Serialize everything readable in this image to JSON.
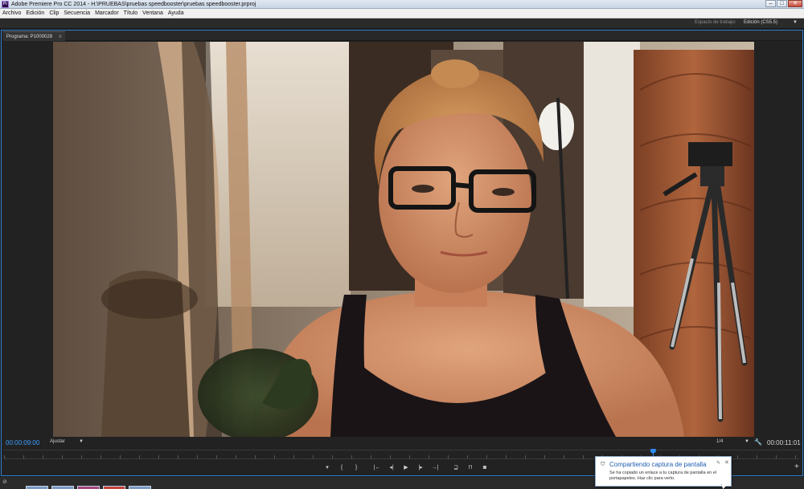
{
  "window": {
    "title": "Adobe Premiere Pro CC 2014 - H:\\PRUEBAS\\pruebas speedbooster\\pruebas speedbooster.prproj",
    "app_icon_label": "Pr",
    "minimize": "–",
    "maximize": "□",
    "close": "✕"
  },
  "menu": [
    "Archivo",
    "Edición",
    "Clip",
    "Secuencia",
    "Marcador",
    "Título",
    "Ventana",
    "Ayuda"
  ],
  "workspace": {
    "label": "Espacio de trabajo:",
    "value": "Edición (CS5.5)",
    "chevron": "▼"
  },
  "panel": {
    "tab_label": "Programa: P1000028",
    "tab_menu": "≡"
  },
  "controls": {
    "current_timecode": "00:00:09:00",
    "fit_label": "Ajustar",
    "fit_chevron": "▼",
    "resolution": "1/4",
    "resolution_chevron": "▼",
    "settings_icon": "🔧",
    "duration_timecode": "00:00:11:01",
    "add_button": "+",
    "playhead_position": 0.815
  },
  "transport": {
    "mark_in_icon": "▾",
    "brace_in": "{",
    "brace_out": "}",
    "go_to_in": "|←",
    "step_back": "◂|",
    "play": "▶",
    "step_forward": "|▸",
    "go_to_out": "→|",
    "insert": "⊒",
    "overwrite": "⊓",
    "export_frame": "◙"
  },
  "status": {
    "icon": "⊘"
  },
  "notification": {
    "icon": "⛉",
    "title": "Compartiendo captura de pantalla",
    "body": "Se ha copiado un enlace a tu captura de pantalla en el portapapeles. Haz clic para verlo.",
    "pin": "✎",
    "close": "✕"
  },
  "colors": {
    "panel_border": "#2f7fcf",
    "timecode_blue": "#3b9fff",
    "playhead": "#2d8cf0",
    "notification_title": "#1f5fb0"
  }
}
